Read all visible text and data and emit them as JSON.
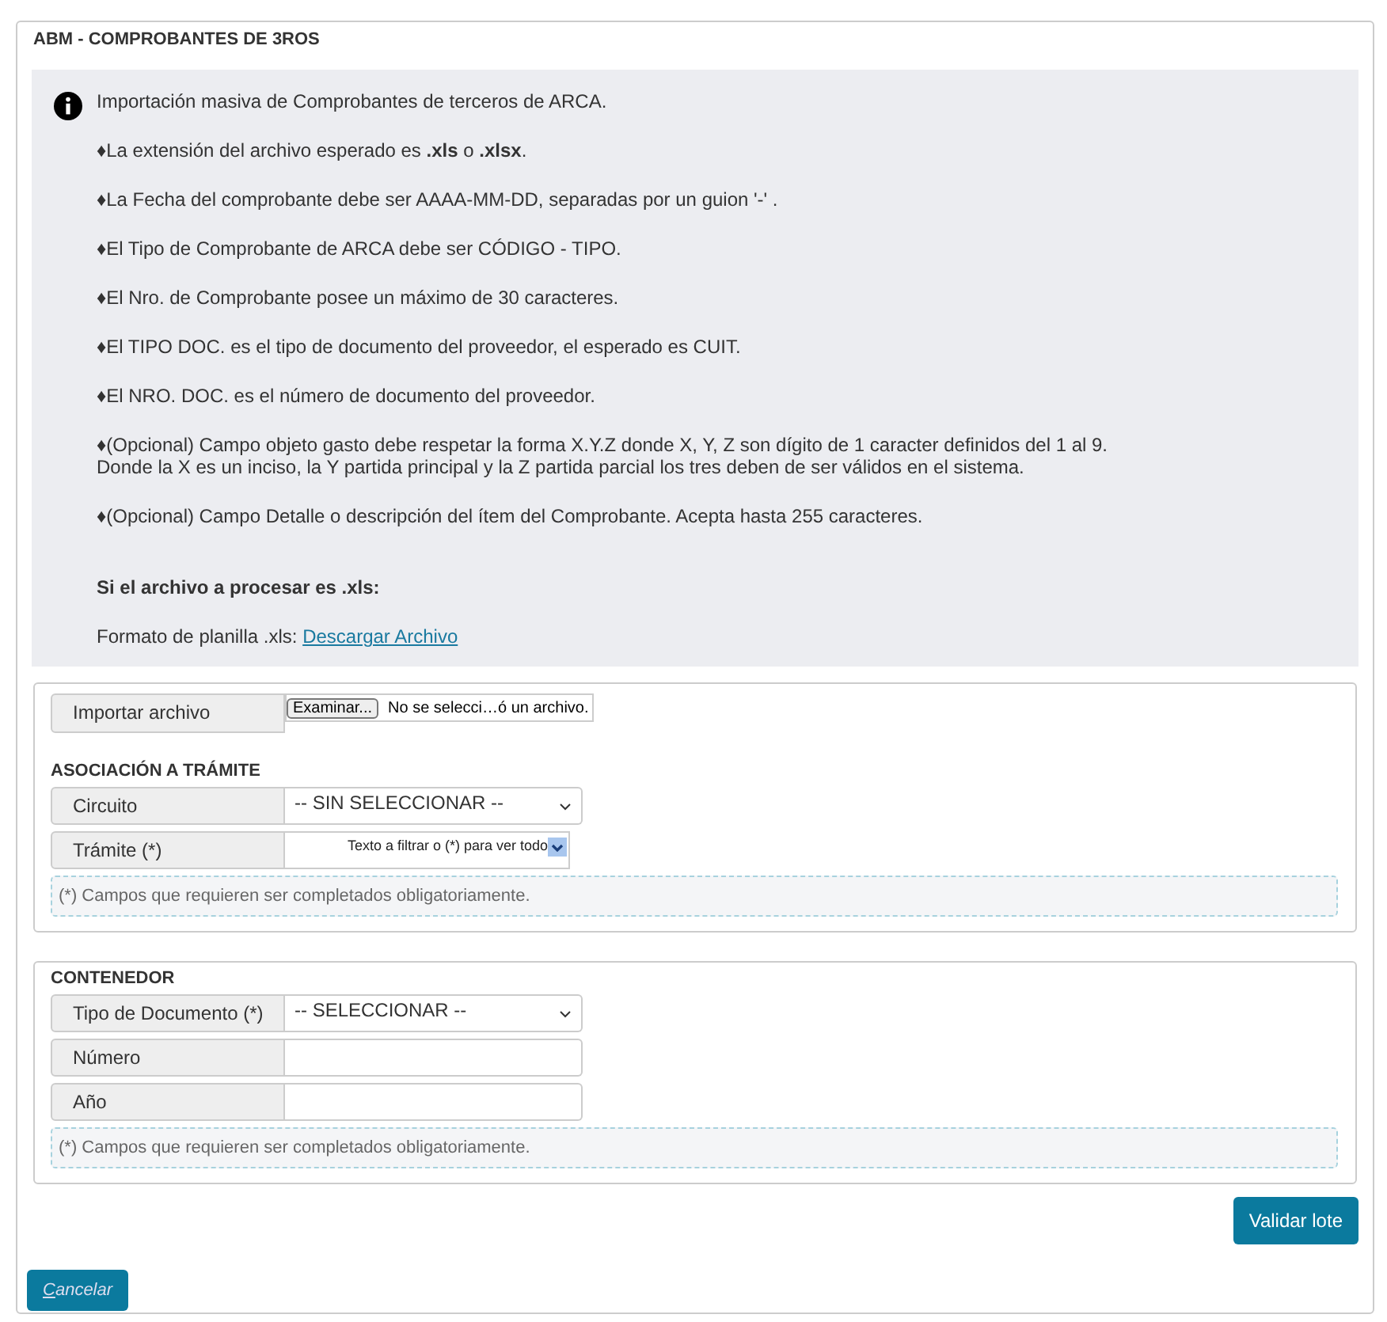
{
  "title": "ABM - COMPROBANTES DE 3ROS",
  "info": {
    "intro": "Importación masiva de Comprobantes de terceros de ARCA.",
    "bullets": [
      "♦La extensión del archivo esperado es **.xls** o **.xlsx**.",
      "♦La Fecha del comprobante debe ser AAAA-MM-DD, separadas por un guion '-' .",
      "♦El Tipo de Comprobante de ARCA debe ser CÓDIGO - TIPO.",
      "♦El Nro. de Comprobante posee un máximo de 30 caracteres.",
      "♦El TIPO DOC. es el tipo de documento del proveedor, el esperado es CUIT.",
      "♦El NRO. DOC. es el número de documento del proveedor.",
      "♦(Opcional) Campo objeto gasto debe respetar la forma X.Y.Z donde X, Y, Z son dígito de 1 caracter definidos del 1 al 9.\nDonde la X es un inciso, la Y partida principal y la Z partida parcial los tres deben de ser válidos en el sistema.",
      "♦(Opcional) Campo Detalle o descripción del ítem del Comprobante. Acepta hasta 255 caracteres."
    ],
    "xls_heading": "Si el archivo a procesar es .xls:",
    "format_label": "Formato de planilla .xls:",
    "download_link": "Descargar Archivo"
  },
  "import": {
    "label": "Importar archivo",
    "browse_button": "Examinar...",
    "file_status": "No se selecci…ó un archivo."
  },
  "tramite_section": {
    "heading": "ASOCIACIÓN A TRÁMITE",
    "rows": [
      {
        "kind": "select",
        "label": "Circuito",
        "value": "-- SIN SELECCIONAR --"
      },
      {
        "kind": "combo",
        "label": "Trámite (*)",
        "placeholder": "Texto a filtrar o (*) para ver todo"
      }
    ],
    "note": "(*) Campos que requieren ser completados obligatoriamente."
  },
  "contenedor_section": {
    "heading": "CONTENEDOR",
    "rows": [
      {
        "kind": "select",
        "label": "Tipo de Documento (*)",
        "value": "-- SELECCIONAR --"
      },
      {
        "kind": "input",
        "label": "Número"
      },
      {
        "kind": "input",
        "label": "Año"
      }
    ],
    "note": "(*) Campos que requieren ser completados obligatoriamente."
  },
  "validate_button": "Validar lote",
  "cancel_button": {
    "access_key": "C",
    "rest": "ancelar"
  }
}
